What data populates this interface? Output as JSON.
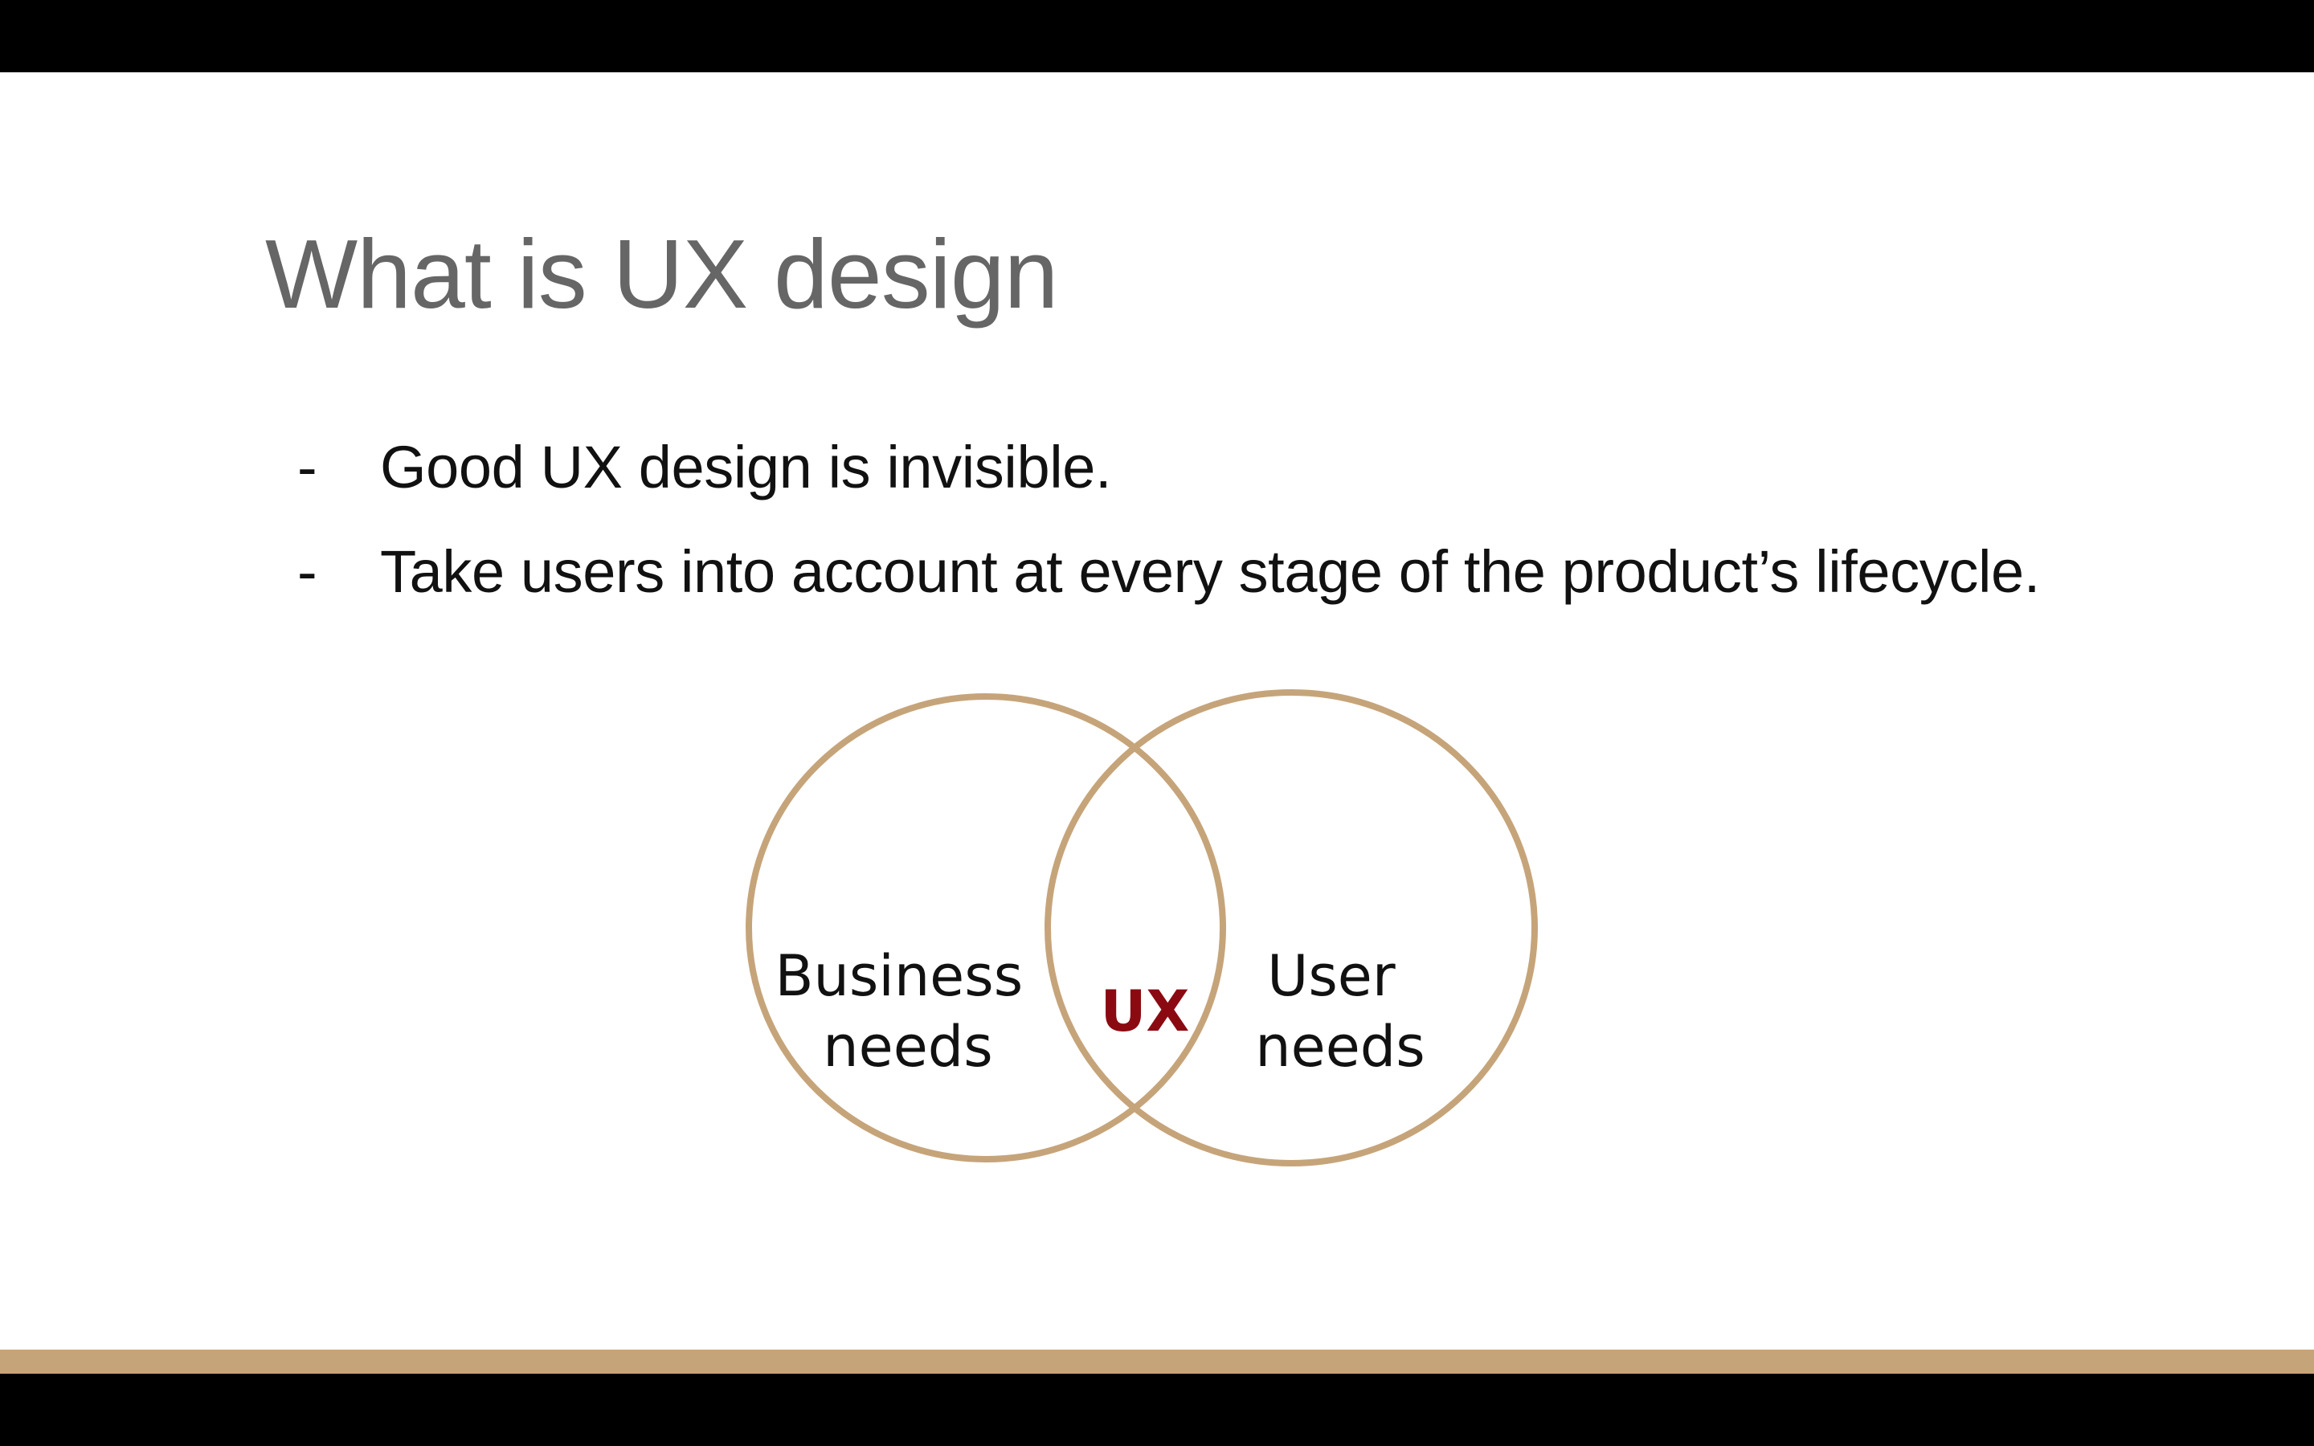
{
  "colors": {
    "frame": "#000000",
    "slide_background": "#ffffff",
    "title": "#666666",
    "body_text": "#111111",
    "accent": "#c6a47a",
    "ux_highlight": "#8b0a12"
  },
  "slide": {
    "title": "What is UX design",
    "bullets": [
      {
        "marker": "-",
        "text": "Good UX design is invisible."
      },
      {
        "marker": "-",
        "text": "Take users into account at every stage of the product’s lifecycle."
      }
    ]
  },
  "venn": {
    "left_label": [
      "Business",
      "needs"
    ],
    "right_label": [
      "User",
      "needs"
    ],
    "center_label": "UX"
  }
}
